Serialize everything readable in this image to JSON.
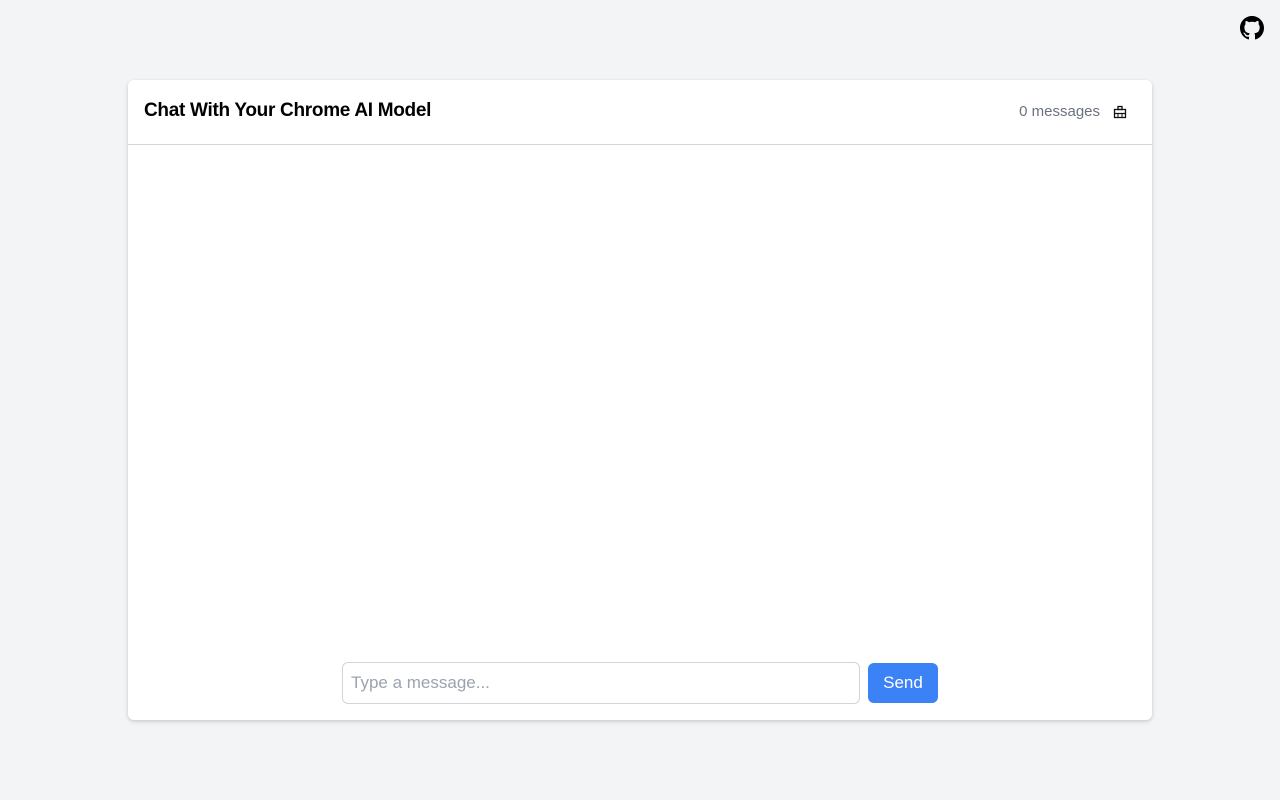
{
  "topbar": {
    "github_icon": "github-icon"
  },
  "chat": {
    "title": "Chat With Your Chrome AI Model",
    "message_count": "0 messages",
    "clear_icon": "clear-chat-icon",
    "messages": []
  },
  "composer": {
    "placeholder": "Type a message...",
    "value": "",
    "send_label": "Send"
  },
  "colors": {
    "background": "#f3f4f6",
    "card": "#ffffff",
    "accent": "#3b82f6",
    "muted_text": "#6b7280",
    "border": "#d1d5db"
  }
}
